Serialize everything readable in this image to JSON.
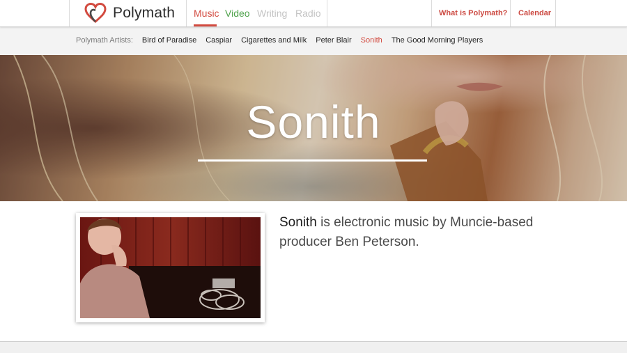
{
  "header": {
    "brand": "Polymath",
    "main_nav": [
      {
        "label": "Music",
        "state": "active",
        "color": "#d24a3f"
      },
      {
        "label": "Video",
        "state": "normal",
        "color": "#4ea24b"
      },
      {
        "label": "Writing",
        "state": "disabled",
        "color": "#c3c3c3"
      },
      {
        "label": "Radio",
        "state": "disabled",
        "color": "#c3c3c3"
      }
    ],
    "right_nav": [
      {
        "label": "What is Polymath?"
      },
      {
        "label": "Calendar"
      }
    ],
    "accent_color": "#d24a3f"
  },
  "artists": {
    "label": "Polymath Artists:",
    "items": [
      {
        "label": "Bird of Paradise"
      },
      {
        "label": "Caspiar"
      },
      {
        "label": "Cigarettes and Milk"
      },
      {
        "label": "Peter Blair"
      },
      {
        "label": "Sonith",
        "active": true
      },
      {
        "label": "The Good Morning Players"
      }
    ]
  },
  "hero": {
    "title": "Sonith"
  },
  "content": {
    "description_name": "Sonith",
    "description_rest": " is electronic music by Muncie-based producer Ben Peterson."
  }
}
